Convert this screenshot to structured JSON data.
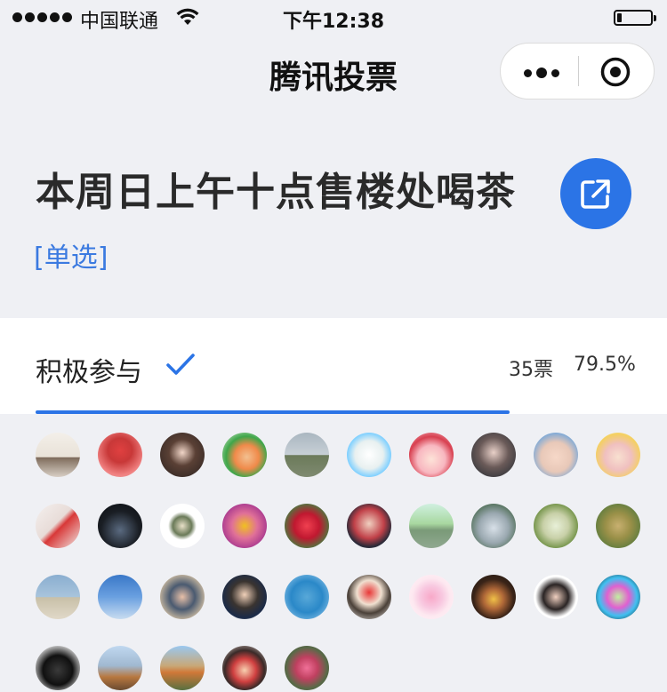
{
  "status_bar": {
    "carrier": "中国联通",
    "time": "下午12:38",
    "battery_level": 0.15
  },
  "nav": {
    "title": "腾讯投票"
  },
  "poll": {
    "title": "本周日上午十点售楼处喝茶",
    "type_label": "[单选]"
  },
  "option": {
    "label": "积极参与",
    "votes": "35票",
    "percent": "79.5%",
    "progress": 0.795,
    "selected": true
  },
  "colors": {
    "accent": "#2b74e6",
    "type_text": "#3b7ae0",
    "background": "#eff0f4"
  },
  "voters": [
    {
      "bg": "linear-gradient(#f3efe9 0%,#e9e2d8 55%,#7d6a5a 56%,#d8cfc5 100%)"
    },
    {
      "bg": "radial-gradient(circle at 50% 40%,#e04040 0%,#c83838 35%,#f08080 70%,#e8b0b0 100%)"
    },
    {
      "bg": "radial-gradient(circle at 50% 45%,#f1d6c8 0%,#5a4035 40%,#2a2220 100%)"
    },
    {
      "bg": "radial-gradient(circle at 55% 55%,#f2c090 0%,#f08a4a 35%,#3fa64a 60%,#e8f2e0 100%)"
    },
    {
      "bg": "linear-gradient(#aab6c0 0%,#c7cfd6 50%,#6b7a5a 51%,#7f8a70 100%)"
    },
    {
      "bg": "radial-gradient(circle at 50% 50%,#ffffff 0%,#e8f0f0 45%,#7fd0ff 70%,#f8a8f0 100%)"
    },
    {
      "bg": "radial-gradient(circle at 50% 60%,#fde3d8 0%,#f8b7c0 40%,#d84050 65%,#f4c0c8 100%)"
    },
    {
      "bg": "radial-gradient(circle at 50% 45%,#e8d0c8 0%,#6a5a58 45%,#1f2830 100%)"
    },
    {
      "bg": "radial-gradient(circle at 50% 55%,#f6d8c8 0%,#e8c8b8 45%,#7aa8d8 75%,#cfe0f0 100%)"
    },
    {
      "bg": "radial-gradient(circle at 50% 55%,#f8e0d0 0%,#f0c0c0 40%,#f4d060 70%,#ffffff 100%)"
    },
    {
      "bg": "linear-gradient(135deg,#f4f0ee 0%,#e8dcd8 45%,#d83838 55%,#f0e8e4 100%)"
    },
    {
      "bg": "radial-gradient(circle at 50% 60%,#5a6a80 0%,#1a1e24 55%,#0a0c10 100%)"
    },
    {
      "bg": "radial-gradient(circle at 50% 50%,#e8e0c8 0%,#6a7a58 30%,#ffffff 45%,#ffffff 100%)"
    },
    {
      "bg": "radial-gradient(circle at 50% 50%,#f0c020 0%,#e07098 40%,#b04090 70%,#704880 100%)"
    },
    {
      "bg": "radial-gradient(circle at 50% 50%,#f04050 0%,#c01830 40%,#4a7a40 75%,#2a4a28 100%)"
    },
    {
      "bg": "radial-gradient(circle at 50% 45%,#f0d0c0 0%,#c04048 45%,#2a2a38 70%,#606070 100%)"
    },
    {
      "bg": "linear-gradient(#d0f0e0 0%,#a8d8a0 45%,#7a9a78 60%,#90a890 100%)"
    },
    {
      "bg": "radial-gradient(circle at 50% 55%,#d8e0e8 0%,#9aa8b0 45%,#4a6a50 80%,#5a7a60 100%)"
    },
    {
      "bg": "radial-gradient(circle at 50% 50%,#e8f0d8 0%,#c8d0a8 40%,#7a9850 70%,#4a6a30 100%)"
    },
    {
      "bg": "radial-gradient(circle at 50% 50%,#c8b070 0%,#9a9048 40%,#6a8040 70%,#4a6030 100%)"
    },
    {
      "bg": "linear-gradient(#8aaed0 0%,#a8c4dc 50%,#c8c0a8 51%,#e0d8c8 100%)"
    },
    {
      "bg": "linear-gradient(#3a78c8 0%,#6aa0e0 50%,#c8dcf0 100%)"
    },
    {
      "bg": "radial-gradient(circle at 50% 50%,#e8c0a8 0%,#4a5a70 40%,#c8b8a0 75%,#8a7a60 100%)"
    },
    {
      "bg": "radial-gradient(circle at 50% 45%,#f0d0b8 0%,#3a3430 40%,#1a2a48 70%,#e8eaf0 100%)"
    },
    {
      "bg": "radial-gradient(circle at 50% 50%,#58a8d8 0%,#2a88c8 50%,#a0d0f0 100%)"
    },
    {
      "bg": "radial-gradient(circle at 50% 40%,#e83838 0%,#f0e0d0 35%,#4a4038 60%,#f0ece8 100%)"
    },
    {
      "bg": "radial-gradient(circle at 50% 50%,#f8a8c8 0%,#f8c8e0 35%,#fde8f0 60%,#fff4f8 100%)"
    },
    {
      "bg": "radial-gradient(circle at 50% 55%,#f0c048 0%,#b06838 30%,#3a2418 60%,#1a1410 100%)"
    },
    {
      "bg": "radial-gradient(circle at 50% 50%,#f0d0c0 0%,#2a2424 40%,#ffffff 65%,#ffffff 100%)"
    },
    {
      "bg": "radial-gradient(circle at 50% 50%,#c0f0a0 0%,#e060d0 35%,#40c0f0 60%,#101818 100%)"
    },
    {
      "bg": "radial-gradient(circle at 50% 55%,#3a3a3a 0%,#101010 45%,#e0e0e0 80%,#f4f4f4 100%)"
    },
    {
      "bg": "linear-gradient(#c0d8f0 0%,#a0b8d0 45%,#b87840 70%,#6a4a30 100%)"
    },
    {
      "bg": "linear-gradient(#9ac8f0 0%,#c8a878 45%,#d07838 60%,#587040 100%)"
    },
    {
      "bg": "radial-gradient(circle at 50% 55%,#f8d0b0 0%,#d04040 35%,#3a2a28 60%,#e8e0d8 100%)"
    },
    {
      "bg": "radial-gradient(circle at 50% 50%,#f07098 0%,#c04060 35%,#5a6a48 65%,#3a4a30 100%)"
    }
  ]
}
